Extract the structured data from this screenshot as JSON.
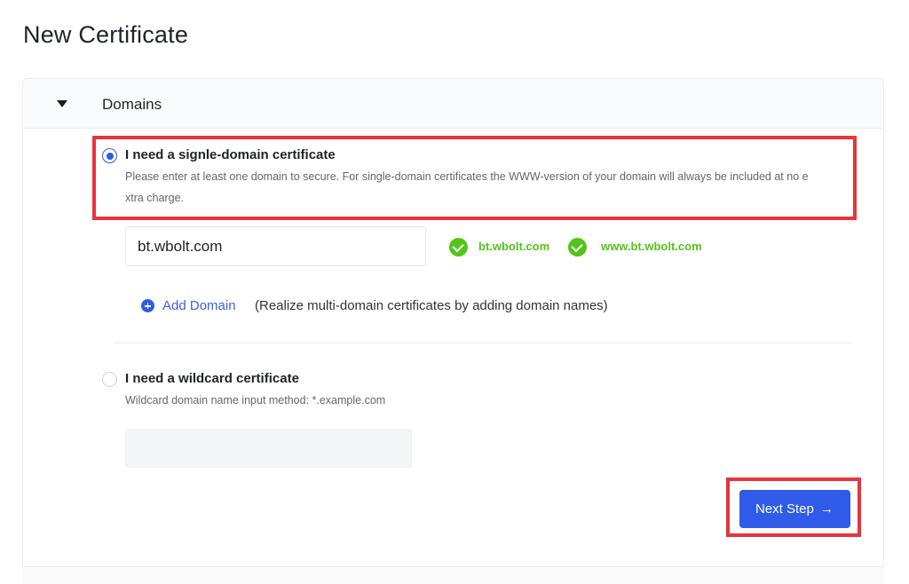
{
  "page": {
    "title": "New Certificate"
  },
  "section": {
    "label": "Domains"
  },
  "single": {
    "title": "I need a signle-domain certificate",
    "desc_line1": "Please enter at least one domain to secure. For single-domain certificates the WWW-version of your domain will always be included at no e",
    "desc_line2": "xtra charge.",
    "input_value": "bt.wbolt.com",
    "checked_domains": [
      "bt.wbolt.com",
      "www.bt.wbolt.com"
    ]
  },
  "add_domain": {
    "label": "Add Domain",
    "note": "(Realize multi-domain certificates by adding domain names)"
  },
  "wildcard": {
    "title": "I need a wildcard certificate",
    "desc": "Wildcard domain name input method: *.example.com",
    "input_value": ""
  },
  "actions": {
    "next_label": "Next Step",
    "next_icon": "arrow-right-icon"
  },
  "colors": {
    "primary": "#2f5be8",
    "success": "#52c41a",
    "highlight": "#e8343a"
  }
}
